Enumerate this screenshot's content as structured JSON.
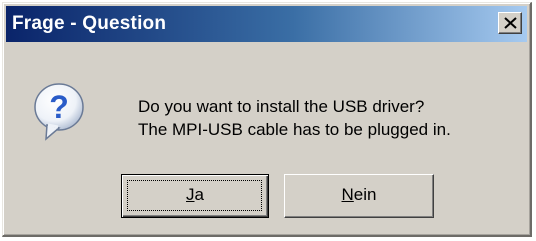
{
  "window": {
    "title": "Frage - Question"
  },
  "message": {
    "line1": "Do you want to install the USB driver?",
    "line2": "The MPI-USB cable has to be plugged in."
  },
  "buttons": {
    "yes": {
      "mnemonic": "J",
      "rest": "a",
      "label": "Ja"
    },
    "no": {
      "mnemonic": "N",
      "rest": "ein",
      "label": "Nein"
    }
  },
  "icons": {
    "dialog": "question-icon",
    "close": "close-icon"
  },
  "colors": {
    "titlebar_start": "#0a246a",
    "titlebar_end": "#a6caf0",
    "dialog_face": "#d4d0c8",
    "icon_blue": "#2a5cc8"
  }
}
